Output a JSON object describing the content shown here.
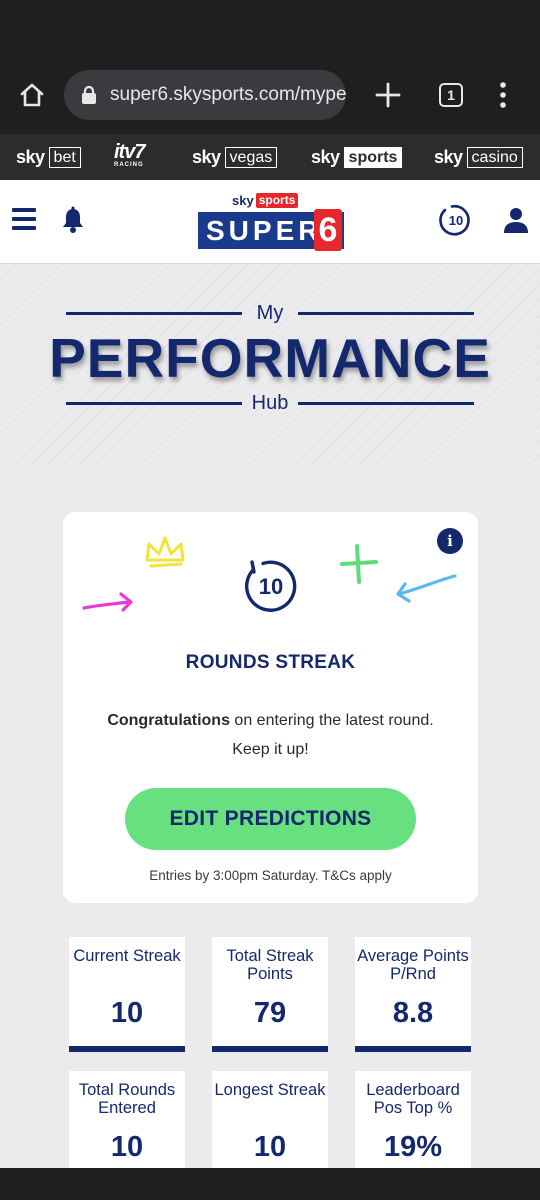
{
  "browser": {
    "url": "super6.skysports.com/mypе",
    "tab_count": "1"
  },
  "brands": {
    "skybet": {
      "sky": "sky",
      "box": "bet"
    },
    "itv7": {
      "main": "itv7",
      "sub": "RACING"
    },
    "skyvegas": {
      "sky": "sky",
      "box": "vegas"
    },
    "skysports": {
      "sky": "sky",
      "box": "sports"
    },
    "skycasino": {
      "sky": "sky",
      "box": "casino"
    }
  },
  "header": {
    "logo_sky": "sky",
    "logo_sports": "sports",
    "logo_word": "SUPER",
    "logo_six": "6",
    "streak_badge": "10"
  },
  "hero": {
    "top": "My",
    "main": "PERFORMANCE",
    "bottom": "Hub"
  },
  "card": {
    "info": "i",
    "streak_number": "10",
    "title": "ROUNDS STREAK",
    "congrats_bold": "Congratulations",
    "congrats_rest": " on entering the latest round. Keep it up!",
    "button": "EDIT PREDICTIONS",
    "note": "Entries by 3:00pm Saturday. T&Cs apply"
  },
  "stats": [
    {
      "label": "Current Streak",
      "value": "10"
    },
    {
      "label": "Total Streak Points",
      "value": "79"
    },
    {
      "label": "Average Points P/Rnd",
      "value": "8.8"
    },
    {
      "label": "Total Rounds Entered",
      "value": "10"
    },
    {
      "label": "Longest Streak",
      "value": "10"
    },
    {
      "label": "Leaderboard Pos Top %",
      "value": "19%"
    }
  ],
  "colors": {
    "navy": "#14286e",
    "green": "#68e07f",
    "red": "#e8262e",
    "pink": "#e83ad6",
    "yellow": "#f2e23a",
    "lightblue": "#5ab8f0",
    "doodle_green": "#5edc7a"
  }
}
